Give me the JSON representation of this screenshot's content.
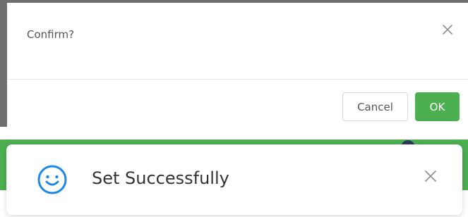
{
  "confirm_dialog": {
    "title": "Confirm?",
    "close_icon": "close-icon",
    "cancel_label": "Cancel",
    "ok_label": "OK"
  },
  "toast": {
    "icon": "smiley-icon",
    "message": "Set Successfully",
    "close_icon": "close-icon"
  },
  "colors": {
    "primary_green": "#4caf50",
    "toast_icon_blue": "#1e88e5",
    "backdrop_gray": "#6f6f6f"
  }
}
